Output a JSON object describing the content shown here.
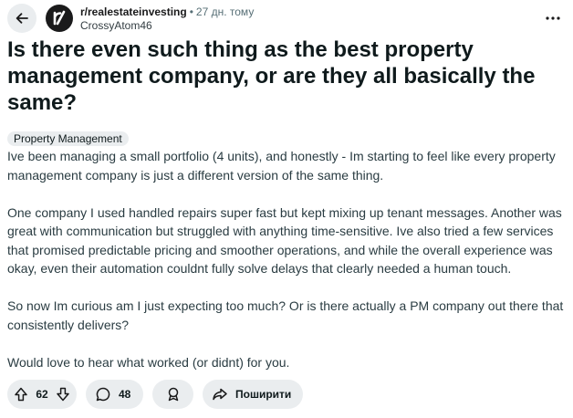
{
  "header": {
    "subreddit": "r/realestateinvesting",
    "separator": "•",
    "time_ago": "27 дн. тому",
    "author": "CrossyAtom46"
  },
  "post": {
    "title": "Is there even such thing as the best property management company, or are they all basically the same?",
    "flair": "Property Management",
    "paragraphs": [
      "Ive been managing a small portfolio (4 units), and honestly - Im starting to feel like every property management company is just a different version of the same thing.",
      "One company I used handled repairs super fast but kept mixing up tenant messages. Another was great with communication but struggled with anything time-sensitive. Ive also tried a few services that promised predictable pricing and smoother operations, and while the overall experience was okay, even their automation couldnt fully solve delays that clearly needed a human touch.",
      "So now Im curious am I just expecting too much? Or is there actually a PM company out there that consistently delivers?",
      "Would love to hear what worked (or didnt) for you."
    ]
  },
  "actions": {
    "vote_count": "62",
    "comment_count": "48",
    "share_label": "Поширити"
  },
  "icons": {
    "back": "arrow-left-icon",
    "subreddit_avatar": "subreddit-avatar-icon",
    "more": "more-horizontal-icon",
    "upvote": "upvote-arrow-icon",
    "downvote": "downvote-arrow-icon",
    "comment": "comment-bubble-icon",
    "award": "award-icon",
    "share": "share-arrow-icon"
  },
  "colors": {
    "pill_bg": "#eaedef",
    "text_primary": "#1a1a1b",
    "text_secondary": "#576f76"
  }
}
